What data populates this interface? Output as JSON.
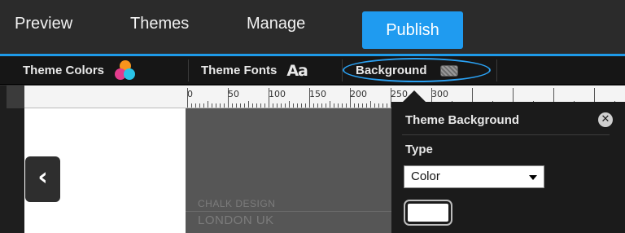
{
  "topnav": {
    "preview": "Preview",
    "themes": "Themes",
    "manage": "Manage",
    "publish": "Publish",
    "accent_color": "#1f9bf0"
  },
  "toolbar": {
    "theme_colors": "Theme Colors",
    "theme_fonts": "Theme Fonts",
    "fonts_icon_text": "Aa",
    "background": "Background"
  },
  "ruler": {
    "labels": [
      "0",
      "50",
      "100",
      "150",
      "200",
      "250",
      "300"
    ]
  },
  "canvas": {
    "line1": "CHALK DESIGN",
    "line2": "LONDON UK"
  },
  "popover": {
    "title": "Theme Background",
    "type_label": "Type",
    "type_value": "Color",
    "swatch_color": "#ffffff"
  },
  "icons": {
    "colors": "theme-colors-icon",
    "fonts": "font-aa-icon",
    "background": "background-swatch-icon",
    "close": "close-icon",
    "back": "chevron-left-icon",
    "dropdown": "chevron-down-icon"
  }
}
